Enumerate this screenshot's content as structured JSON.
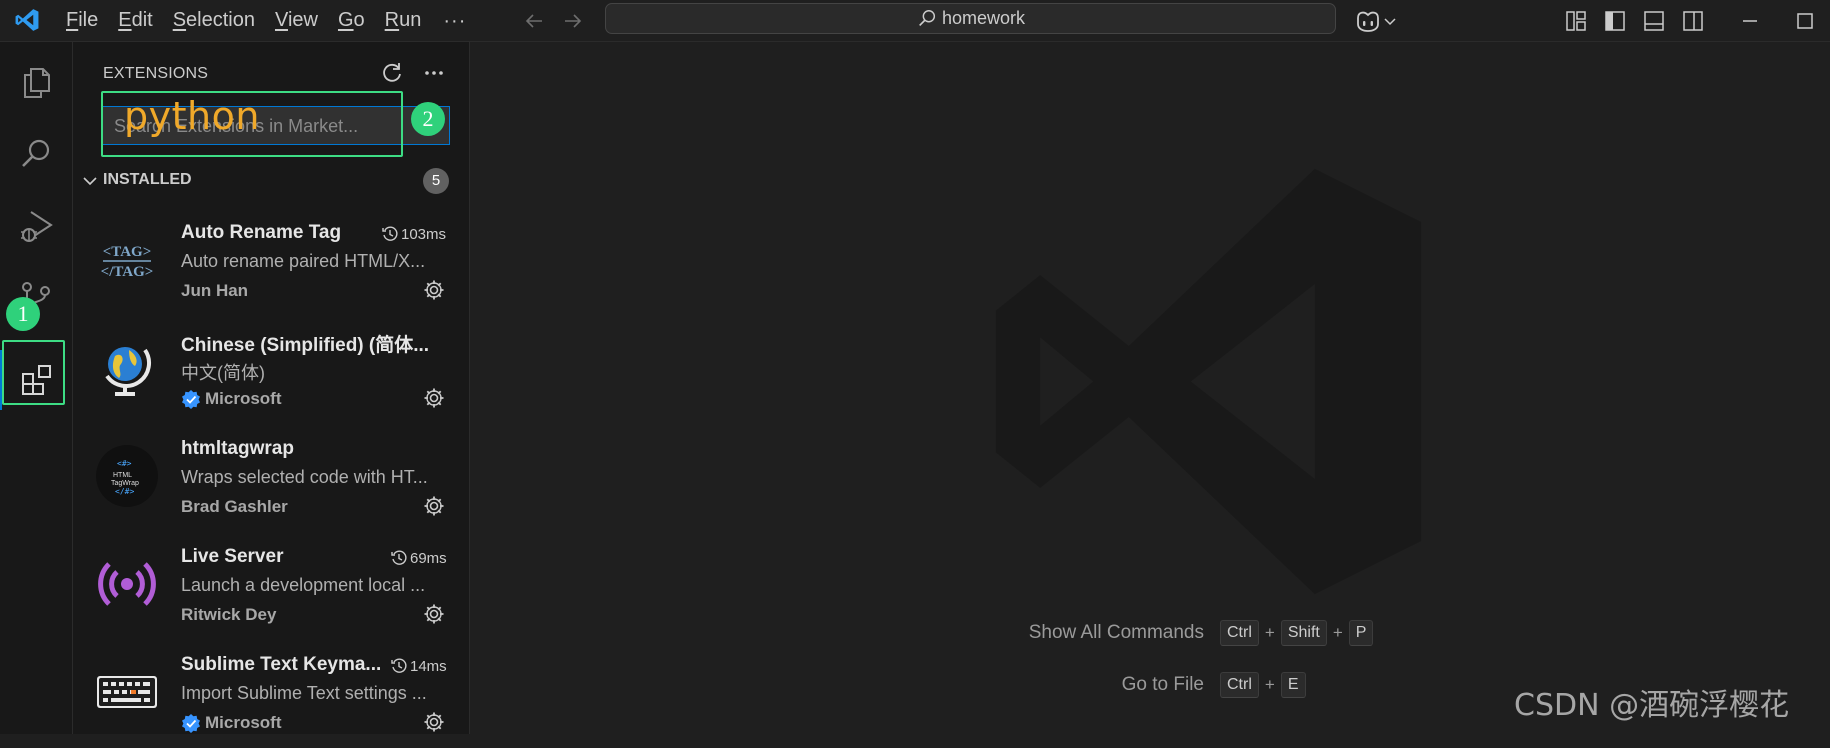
{
  "menubar": {
    "items": [
      {
        "mnemonic": "F",
        "rest": "ile"
      },
      {
        "mnemonic": "E",
        "rest": "dit"
      },
      {
        "mnemonic": "S",
        "rest": "election"
      },
      {
        "mnemonic": "V",
        "rest": "iew"
      },
      {
        "mnemonic": "G",
        "rest": "o"
      },
      {
        "mnemonic": "R",
        "rest": "un"
      }
    ],
    "more": "···"
  },
  "command_center": {
    "text": "homework"
  },
  "sidebar": {
    "title": "EXTENSIONS",
    "search": {
      "placeholder": "Search Extensions in Market..."
    },
    "section": {
      "label": "INSTALLED",
      "count": "5"
    },
    "extensions": [
      {
        "name": "Auto Rename Tag",
        "time": "103ms",
        "description": "Auto rename paired HTML/X...",
        "publisher": "Jun Han",
        "verified": false,
        "icon": "tag-icon"
      },
      {
        "name": "Chinese (Simplified) (简体...",
        "time": "",
        "description": "中文(简体)",
        "publisher": "Microsoft",
        "verified": true,
        "icon": "globe-icon"
      },
      {
        "name": "htmltagwrap",
        "time": "",
        "description": "Wraps selected code with HT...",
        "publisher": "Brad Gashler",
        "verified": false,
        "icon": "html-wrap-icon"
      },
      {
        "name": "Live Server",
        "time": "69ms",
        "description": "Launch a development local ...",
        "publisher": "Ritwick Dey",
        "verified": false,
        "icon": "broadcast-icon"
      },
      {
        "name": "Sublime Text Keyma...",
        "time": "14ms",
        "description": "Import Sublime Text settings ...",
        "publisher": "Microsoft",
        "verified": true,
        "icon": "keyboard-icon"
      }
    ]
  },
  "editor": {
    "hints": [
      {
        "label": "Show All Commands",
        "keys": [
          "Ctrl",
          "Shift",
          "P"
        ]
      },
      {
        "label": "Go to File",
        "keys": [
          "Ctrl",
          "E"
        ]
      }
    ]
  },
  "annotations": {
    "step1": "1",
    "step2": "2",
    "typed_text": "python",
    "watermark": "CSDN @酒碗浮樱花"
  },
  "colors": {
    "accent": "#0078d4",
    "annotation_green": "#3ddc84",
    "annotation_text": "#f0a92a"
  }
}
